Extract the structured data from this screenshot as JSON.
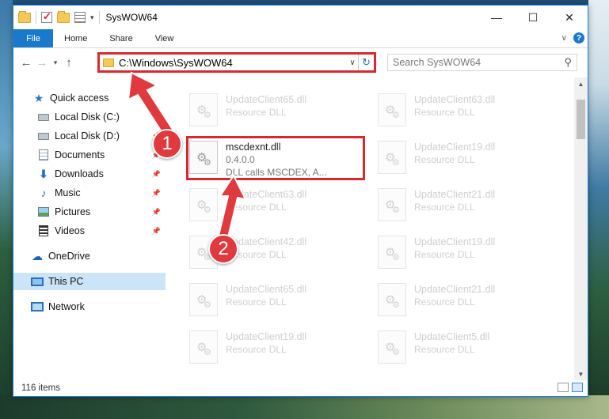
{
  "window": {
    "title": "SysWOW64",
    "controls": {
      "minimize": "—",
      "maximize": "☐",
      "close": "✕"
    }
  },
  "ribbon": {
    "file_tab": "File",
    "tabs": [
      "Home",
      "Share",
      "View"
    ]
  },
  "address": {
    "path": "C:\\Windows\\SysWOW64",
    "search_placeholder": "Search SysWOW64"
  },
  "nav_pane": {
    "items": [
      {
        "label": "Quick access",
        "icon": "star-icon"
      },
      {
        "label": "Local Disk (C:)",
        "icon": "drive-icon"
      },
      {
        "label": "Local Disk (D:)",
        "icon": "drive-icon",
        "pinned": true
      },
      {
        "label": "Documents",
        "icon": "documents-icon",
        "pinned": true
      },
      {
        "label": "Downloads",
        "icon": "downloads-icon",
        "pinned": true
      },
      {
        "label": "Music",
        "icon": "music-icon",
        "pinned": true
      },
      {
        "label": "Pictures",
        "icon": "pictures-icon",
        "pinned": true
      },
      {
        "label": "Videos",
        "icon": "videos-icon",
        "pinned": true
      },
      {
        "label": "OneDrive",
        "icon": "onedrive-icon"
      },
      {
        "label": "This PC",
        "icon": "this-pc-icon",
        "selected": true
      },
      {
        "label": "Network",
        "icon": "network-icon"
      }
    ]
  },
  "files": {
    "left": [
      {
        "name": "UpdateClient65.dll",
        "type": "Resource DLL"
      },
      {
        "name": "mscdexnt.dll",
        "version": "0.4.0.0",
        "description": "DLL calls MSCDEX, A..."
      },
      {
        "name": "UpdateClient63.dll",
        "type": "Resource DLL"
      },
      {
        "name": "UpdateClient42.dll",
        "type": "Resource DLL"
      },
      {
        "name": "UpdateClient65.dll",
        "type": "Resource DLL"
      },
      {
        "name": "UpdateClient19.dll",
        "type": "Resource DLL"
      }
    ],
    "right": [
      {
        "name": "UpdateClient63.dll",
        "type": "Resource DLL"
      },
      {
        "name": "UpdateClient19.dll",
        "type": "Resource DLL"
      },
      {
        "name": "UpdateClient21.dll",
        "type": "Resource DLL"
      },
      {
        "name": "UpdateClient19.dll",
        "type": "Resource DLL"
      },
      {
        "name": "UpdateClient21.dll",
        "type": "Resource DLL"
      },
      {
        "name": "UpdateClient5.dll",
        "type": "Resource DLL"
      }
    ]
  },
  "status": {
    "item_count": "116 items"
  },
  "callouts": {
    "step1": "1",
    "step2": "2",
    "color": "#e0393e"
  },
  "colors": {
    "accent": "#1979ca",
    "highlight_border": "#d9282e",
    "selection": "#cce4f7"
  }
}
